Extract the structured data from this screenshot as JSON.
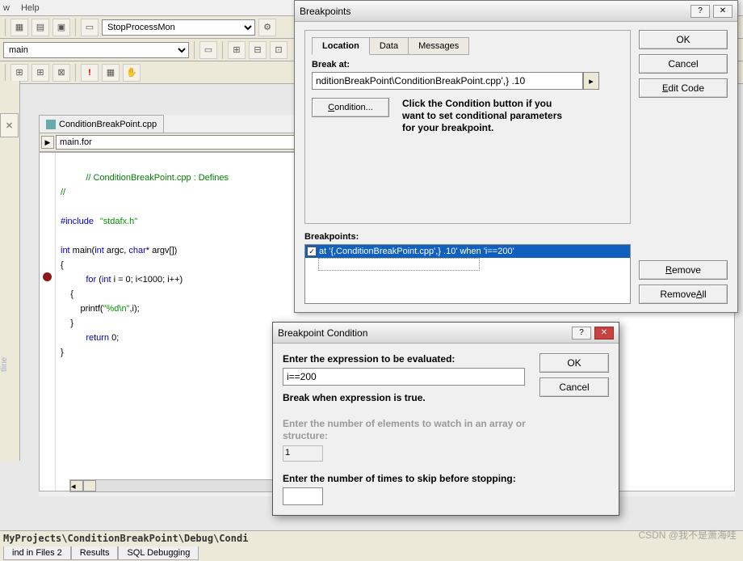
{
  "menu": {
    "window": "w",
    "help": "Help"
  },
  "toolbar": {
    "combo1": "StopProcessMon",
    "combo2": "main"
  },
  "editor": {
    "tab": "ConditionBreakPoint.cpp",
    "nav": "main.for",
    "code": {
      "l1": "// ConditionBreakPoint.cpp : Defines",
      "l2": "//",
      "l3a": "#include",
      "l3b": "\"stdafx.h\"",
      "l4a": "int",
      "l4b": " main(",
      "l4c": "int",
      "l4d": " argc, ",
      "l4e": "char",
      "l4f": "* argv[])",
      "l5": "{",
      "l6a": "for",
      "l6b": " (",
      "l6c": "int",
      "l6d": " i = 0; i<1000; i++)",
      "l7": "    {",
      "l8a": "        printf(",
      "l8b": "\"%d\\n\"",
      "l8c": ",i);",
      "l9": "    }",
      "l10a": "return",
      "l10b": " 0;",
      "l11": "}"
    }
  },
  "bp_dialog": {
    "title": "Breakpoints",
    "tabs": {
      "location": "Location",
      "data": "Data",
      "messages": "Messages"
    },
    "break_at_label": "Break at:",
    "break_at_value": "nditionBreakPoint\\ConditionBreakPoint.cpp',} .10",
    "condition_btn": "Condition...",
    "help_text": "Click the Condition button if you want to set conditional parameters for your breakpoint.",
    "list_label": "Breakpoints:",
    "list_item": "at '{,ConditionBreakPoint.cpp',} .10'  when 'i==200'",
    "ok": "OK",
    "cancel": "Cancel",
    "edit_code": "Edit Code",
    "remove": "Remove",
    "remove_all": "Remove All"
  },
  "cond_dialog": {
    "title": "Breakpoint Condition",
    "expr_label": "Enter the expression to be evaluated:",
    "expr_value": "i==200",
    "true_label": "Break when expression is true.",
    "elems_label": "Enter the number of elements to watch in an array or structure:",
    "elems_value": "1",
    "skip_label": "Enter the number of times to skip before stopping:",
    "skip_value": "",
    "ok": "OK",
    "cancel": "Cancel"
  },
  "status_path": "MyProjects\\ConditionBreakPoint\\Debug\\Condi",
  "bottom_tabs": {
    "find": "ind in Files 2",
    "results": "Results",
    "sql": "SQL Debugging"
  },
  "sidetab": "✕",
  "sidelabel": "tline",
  "watermark": "CSDN @我不是萧海哇"
}
